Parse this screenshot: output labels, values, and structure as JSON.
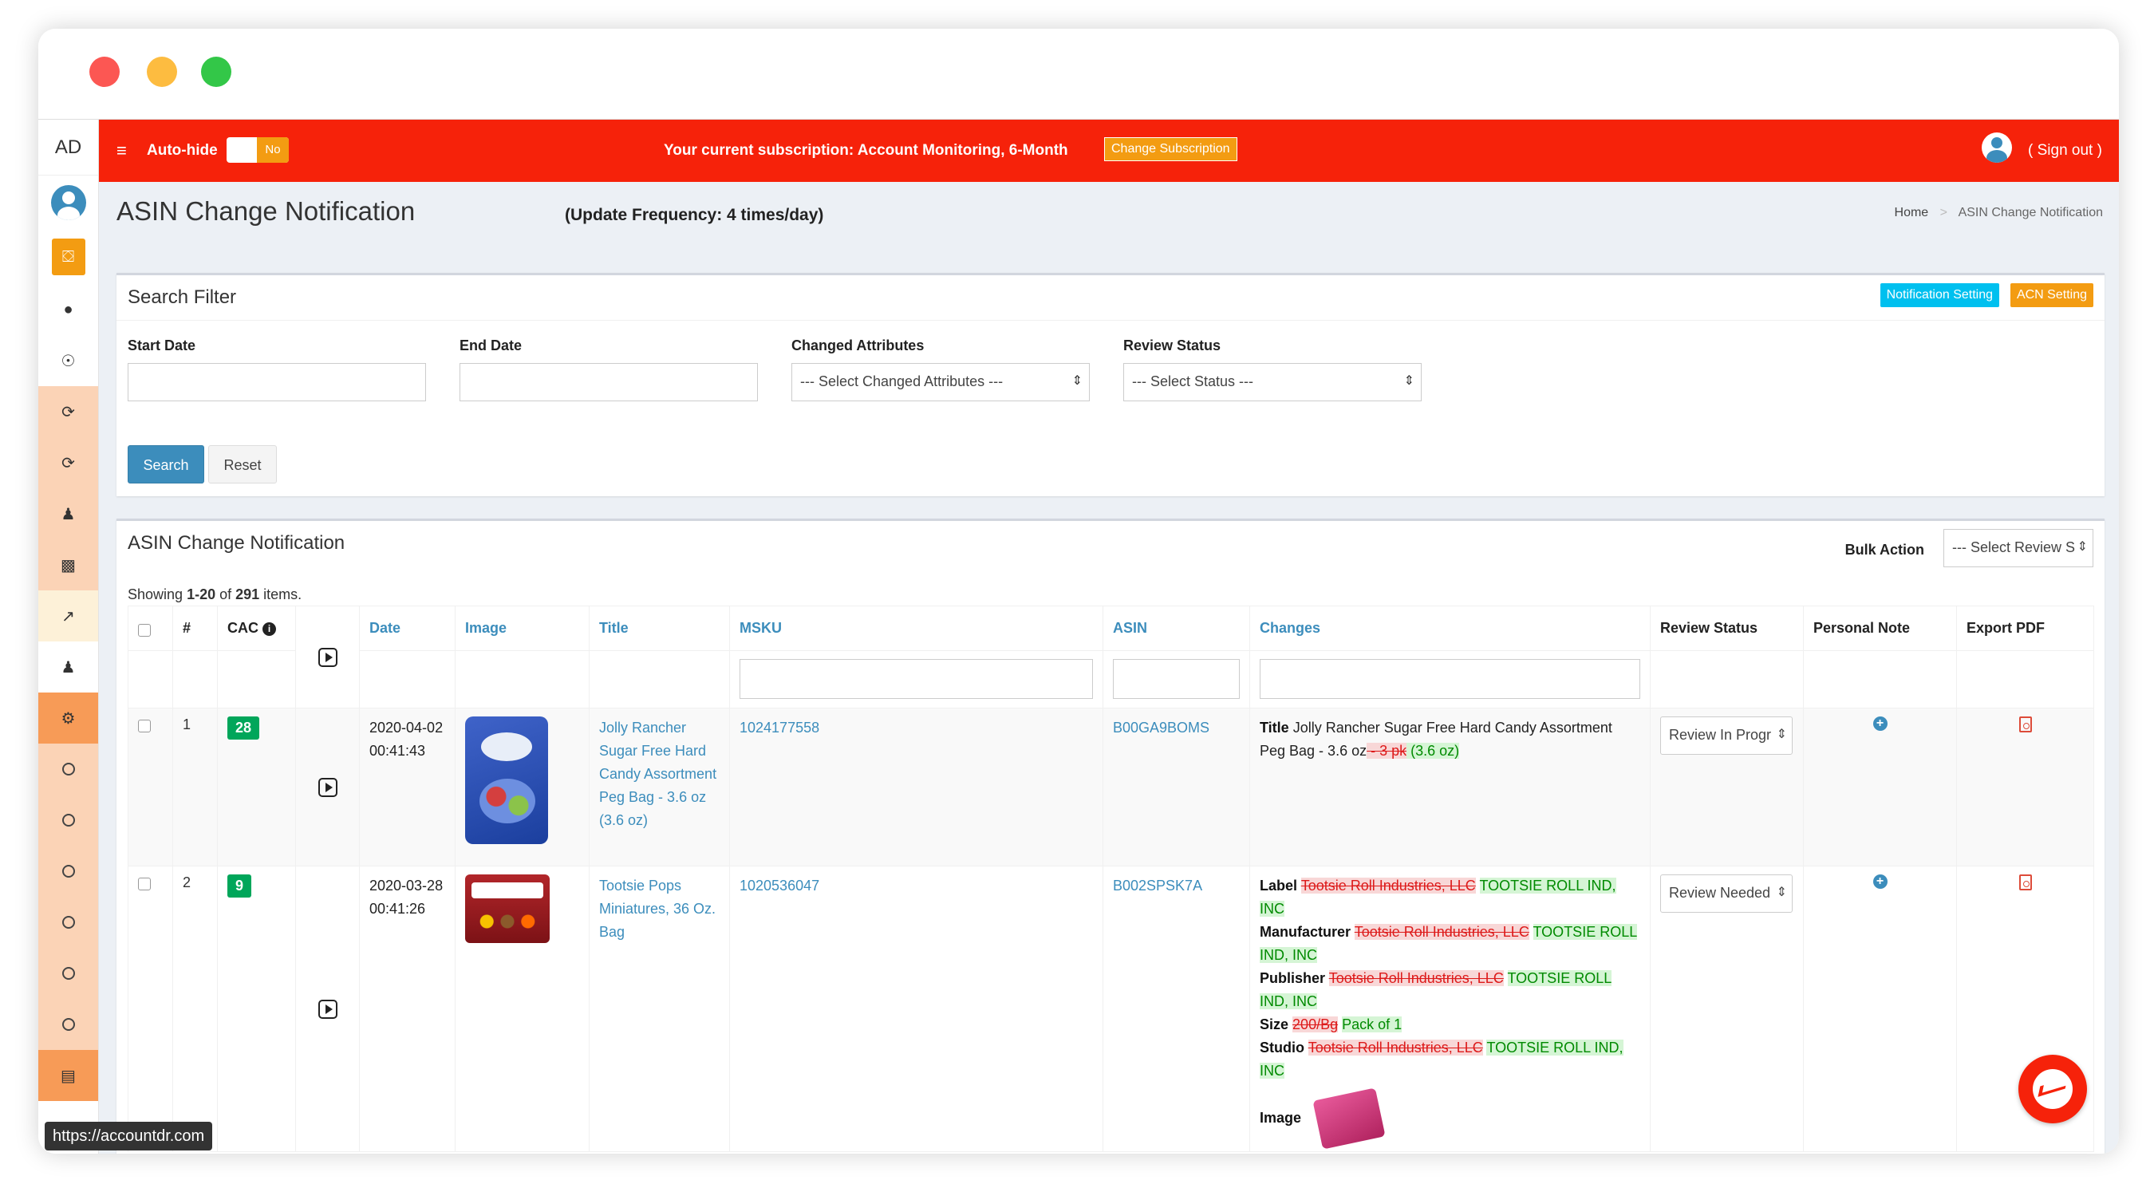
{
  "browser": {
    "status_url": "https://accountdr.com"
  },
  "sidebar": {
    "logo": "AD",
    "items": [
      {
        "icon": "user-avatar-icon"
      },
      {
        "icon": "lock-icon"
      },
      {
        "icon": "dashboard-icon"
      },
      {
        "icon": "user-circle-icon"
      },
      {
        "icon": "refresh-icon"
      },
      {
        "icon": "refresh-icon"
      },
      {
        "icon": "users-icon"
      },
      {
        "icon": "money-icon"
      },
      {
        "icon": "chart-line-icon"
      },
      {
        "icon": "user-icon"
      },
      {
        "icon": "gear-icon"
      },
      {
        "icon": "circle-icon"
      },
      {
        "icon": "circle-icon"
      },
      {
        "icon": "circle-icon"
      },
      {
        "icon": "circle-icon"
      },
      {
        "icon": "circle-icon"
      },
      {
        "icon": "circle-icon"
      },
      {
        "icon": "bar-chart-icon"
      }
    ]
  },
  "topbar": {
    "menu_glyph": "≡",
    "autohide_label": "Auto-hide",
    "toggle_value": "No",
    "subscription_text": "Your current subscription: Account Monitoring, 6-Month",
    "change_subscription": "Change Subscription",
    "signout": "( Sign out )",
    "bg_color": "#f6220a"
  },
  "page": {
    "title": "ASIN Change Notification",
    "frequency": "(Update Frequency: 4 times/day)",
    "breadcrumb": {
      "home": "Home",
      "separator": ">",
      "current": "ASIN Change Notification"
    }
  },
  "filter": {
    "title": "Search Filter",
    "notification_setting": "Notification Setting",
    "acn_setting": "ACN Setting",
    "start_date_label": "Start Date",
    "end_date_label": "End Date",
    "changed_attributes_label": "Changed Attributes",
    "changed_attributes_value": "--- Select Changed Attributes ---",
    "review_status_label": "Review Status",
    "review_status_value": "--- Select Status ---",
    "select_arrow": "⇕",
    "search": "Search",
    "reset": "Reset"
  },
  "results": {
    "title": "ASIN Change Notification",
    "bulk_action_label": "Bulk Action",
    "bulk_action_value": "--- Select Review S",
    "showing_prefix": "Showing ",
    "showing_range": "1-20",
    "showing_of": " of ",
    "showing_total": "291",
    "showing_suffix": " items.",
    "columns": {
      "num": "#",
      "cac": "CAC",
      "date": "Date",
      "image": "Image",
      "title": "Title",
      "msku": "MSKU",
      "asin": "ASIN",
      "changes": "Changes",
      "review_status": "Review Status",
      "personal_note": "Personal Note",
      "export_pdf": "Export PDF"
    },
    "rows": [
      {
        "num": "1",
        "cac": "28",
        "date": "2020-04-02",
        "time": "00:41:43",
        "title": "Jolly Rancher Sugar Free Hard Candy Assortment Peg Bag - 3.6 oz (3.6 oz)",
        "msku": "1024177558",
        "asin": "B00GA9BOMS",
        "changes": {
          "title_label": "Title",
          "title_text": "Jolly Rancher Sugar Free Hard Candy Assortment Peg Bag - 3.6 oz",
          "title_removed": " - 3 pk",
          "title_added": " (3.6 oz)"
        },
        "review_status": "Review In Progr"
      },
      {
        "num": "2",
        "cac": "9",
        "date": "2020-03-28",
        "time": "00:41:26",
        "title": "Tootsie Pops Miniatures, 36 Oz. Bag",
        "msku": "1020536047",
        "asin": "B002SPSK7A",
        "changes": {
          "label_label": "Label",
          "label_removed": "Tootsie Roll Industries, LLC",
          "label_added": "TOOTSIE ROLL IND, INC",
          "manufacturer_label": "Manufacturer",
          "manufacturer_removed": "Tootsie Roll Industries, LLC",
          "manufacturer_added": "TOOTSIE ROLL IND, INC",
          "publisher_label": "Publisher",
          "publisher_removed": "Tootsie Roll Industries, LLC",
          "publisher_added": "TOOTSIE ROLL IND, INC",
          "size_label": "Size",
          "size_removed": "200/Bg",
          "size_added": "Pack of 1",
          "studio_label": "Studio",
          "studio_removed": "Tootsie Roll Industries, LLC",
          "studio_added": "TOOTSIE ROLL IND, INC",
          "image_label": "Image"
        },
        "review_status": "Review Needed"
      }
    ]
  }
}
